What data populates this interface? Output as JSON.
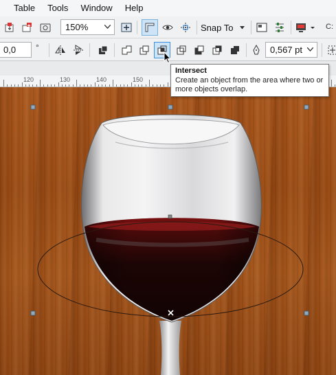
{
  "menu": [
    "Table",
    "Tools",
    "Window",
    "Help"
  ],
  "toolbar": {
    "zoom_value": "150%",
    "snap_to_label": "Snap To",
    "trailing_label": "C:"
  },
  "property_bar": {
    "angle_value": "0,0",
    "angle_unit": "°",
    "outline_width": "0,567 pt"
  },
  "ruler": {
    "labels": [
      "120",
      "130",
      "140",
      "150"
    ]
  },
  "tooltip": {
    "title": "Intersect",
    "description": "Create an object from the area where two or more objects overlap."
  },
  "colors": {
    "accent": "#0078d7",
    "wood": "#9b4c14",
    "wine": "#2a0606",
    "handle": "#7f9fb8"
  }
}
